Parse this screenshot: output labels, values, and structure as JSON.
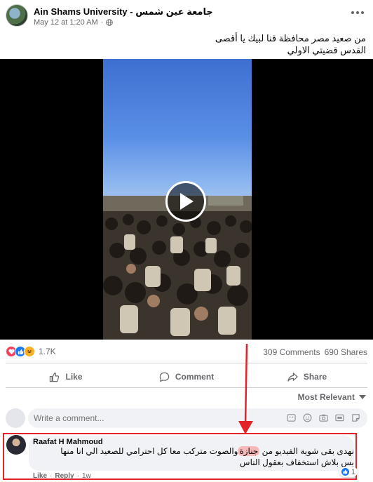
{
  "post": {
    "page_name": "Ain Shams University - جامعة عين شمس",
    "date": "May 12 at 1:20 AM",
    "date_separator": "·",
    "caption_line1": "من صعيد مصر محافظة قنا لبيك يا أقصى",
    "caption_line2": "القدس قضيتي الاولي"
  },
  "stats": {
    "reaction_count": "1.7K",
    "comments": "309 Comments",
    "shares": "690 Shares",
    "reaction_icons": [
      "heart-icon",
      "like-icon",
      "haha-icon"
    ]
  },
  "actions": {
    "like": "Like",
    "comment": "Comment",
    "share": "Share"
  },
  "comments_section": {
    "sort_label": "Most Relevant",
    "composer_placeholder": "Write a comment...",
    "composer_icons": [
      "emoji-icon",
      "camera-icon",
      "gif-icon",
      "sticker-icon"
    ]
  },
  "comment": {
    "author": "Raafat H Mahmoud",
    "text_before": "نهدى بقى شوية الفيديو من ",
    "highlighted_word": "جنازة",
    "text_after": "والصوت متركب معا كل احترامي للصعيد الي انا منها بس بلاش استخفاف بعقول الناس",
    "like_count": "1",
    "like_label": "Like",
    "reply_label": "Reply",
    "time": "1w",
    "separator": "·"
  },
  "colors": {
    "annotation_red": "#e2232a",
    "highlight_pink": "#f6b8b8",
    "facebook_blue": "#1877f2"
  }
}
